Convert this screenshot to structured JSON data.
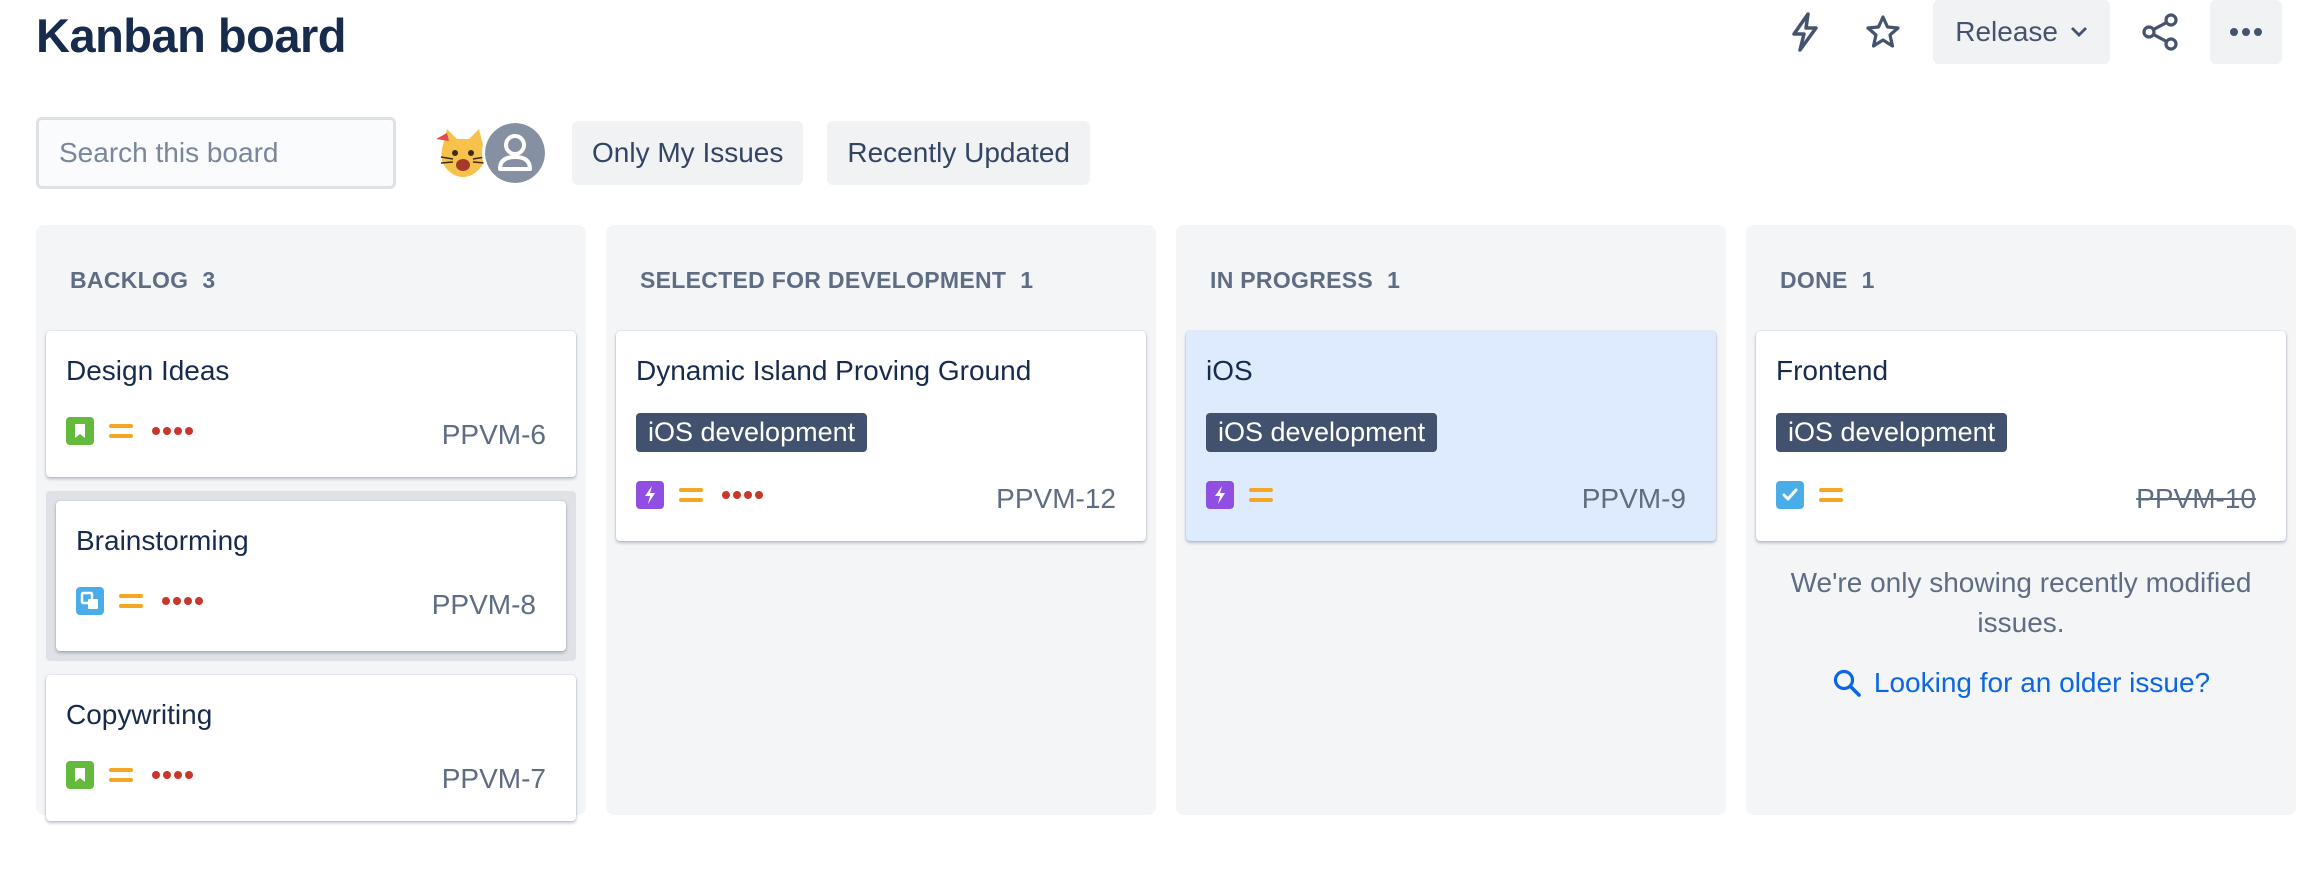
{
  "header": {
    "title": "Kanban board",
    "release_label": "Release"
  },
  "toolbar": {
    "search_placeholder": "Search this board",
    "filters": [
      "Only My Issues",
      "Recently Updated"
    ]
  },
  "columns": [
    {
      "name": "BACKLOG",
      "count": "3",
      "cards": [
        {
          "title": "Design Ideas",
          "key": "PPVM-6",
          "type": "story"
        },
        {
          "title": "Brainstorming",
          "key": "PPVM-8",
          "type": "subtask"
        },
        {
          "title": "Copywriting",
          "key": "PPVM-7",
          "type": "story"
        }
      ]
    },
    {
      "name": "SELECTED FOR DEVELOPMENT",
      "count": "1",
      "cards": [
        {
          "title": "Dynamic Island Proving Ground",
          "key": "PPVM-12",
          "epic": "iOS development",
          "type": "epic"
        }
      ]
    },
    {
      "name": "IN PROGRESS",
      "count": "1",
      "cards": [
        {
          "title": "iOS",
          "key": "PPVM-9",
          "epic": "iOS development",
          "type": "epic"
        }
      ]
    },
    {
      "name": "DONE",
      "count": "1",
      "cards": [
        {
          "title": "Frontend",
          "key": "PPVM-10",
          "epic": "iOS development",
          "type": "task"
        }
      ],
      "note": "We're only showing recently modified issues.",
      "link": "Looking for an older issue?"
    }
  ],
  "colors": {
    "story": "#63ba3c",
    "subtask": "#4bade8",
    "epic": "#904ee2",
    "task": "#4bade8",
    "priority_medium": "#f5a623",
    "priority_dots": "#c9372c",
    "epic_label_bg": "#42526e",
    "link": "#0c66e4"
  }
}
